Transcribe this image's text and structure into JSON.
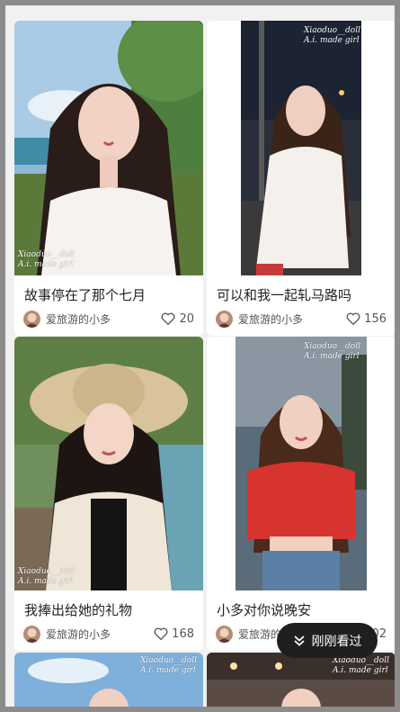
{
  "feed": {
    "cards": [
      {
        "title": "故事停在了那个七月",
        "author": "爱旅游的小多",
        "likes": "20",
        "watermark": ""
      },
      {
        "title": "可以和我一起轧马路吗",
        "author": "爱旅游的小多",
        "likes": "156",
        "watermark": "Xiaoduo__doll\nA.i. made girl"
      },
      {
        "title": "我捧出给她的礼物",
        "author": "爱旅游的小多",
        "likes": "168",
        "watermark": "Xiaoduo__doll\nA.i. made girl"
      },
      {
        "title": "小多对你说晚安",
        "author": "爱旅游的小多",
        "likes": "202",
        "watermark": "Xiaoduo__doll\nA.i. made girl"
      }
    ],
    "bottom_watermarks": [
      "Xiaoduo__doll\nA.i. made girl",
      "Xiaoduo__doll\nA.i. made girl"
    ],
    "card0_watermark": "Xiaoduo__doll\nA.i. made girl"
  },
  "fab": {
    "label": "刚刚看过",
    "icon": "double-chevron-down-icon"
  },
  "colors": {
    "background": "#f1f1f1",
    "card": "#ffffff",
    "fab": "#1f1f1f"
  }
}
